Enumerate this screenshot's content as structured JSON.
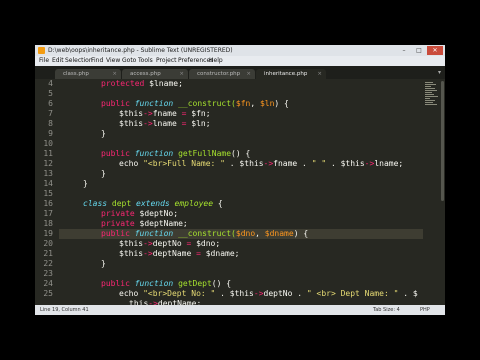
{
  "window": {
    "title": "D:\\web\\oops\\inheritance.php - Sublime Text (UNREGISTERED)",
    "controls": [
      "–",
      "□",
      "✕"
    ]
  },
  "menu": [
    "File",
    "Edit",
    "Selection",
    "Find",
    "View",
    "Goto",
    "Tools",
    "Project",
    "Preferences",
    "Help"
  ],
  "tabs": [
    {
      "label": "class.php",
      "active": false
    },
    {
      "label": "access.php",
      "active": false
    },
    {
      "label": "constructor.php",
      "active": false
    },
    {
      "label": "inheritance.php",
      "active": true
    }
  ],
  "line_numbers": [
    "4",
    "5",
    "6",
    "7",
    "8",
    "9",
    "10",
    "11",
    "12",
    "13",
    "14",
    "15",
    "16",
    "17",
    "18",
    "19",
    "20",
    "21",
    "22",
    "23",
    "24",
    "25",
    ""
  ],
  "code_lines": [
    [
      [
        "protected",
        "k"
      ],
      [
        " $lname;",
        ""
      ]
    ],
    [],
    [
      [
        "public ",
        "k"
      ],
      [
        "function",
        "s"
      ],
      [
        " __construct(",
        "f"
      ],
      [
        "$fn",
        "v"
      ],
      [
        ", ",
        ""
      ],
      [
        "$ln",
        "v"
      ],
      [
        ") {",
        ""
      ]
    ],
    [
      [
        "$this",
        ""
      ],
      [
        "->",
        "arr"
      ],
      [
        "fname ",
        ""
      ],
      [
        "=",
        "k"
      ],
      [
        " $fn;",
        ""
      ]
    ],
    [
      [
        "$this",
        ""
      ],
      [
        "->",
        "arr"
      ],
      [
        "lname ",
        ""
      ],
      [
        "=",
        "k"
      ],
      [
        " $ln;",
        ""
      ]
    ],
    [
      [
        "}",
        ""
      ]
    ],
    [],
    [
      [
        "public ",
        "k"
      ],
      [
        "function",
        "s"
      ],
      [
        " getFullName",
        "f"
      ],
      [
        "() {",
        ""
      ]
    ],
    [
      [
        "echo ",
        ""
      ],
      [
        "\"<br>Full Name: \"",
        "str"
      ],
      [
        " . $this",
        ""
      ],
      [
        "->",
        "arr"
      ],
      [
        "fname . ",
        ""
      ],
      [
        "\" \"",
        "str"
      ],
      [
        " . $this",
        ""
      ],
      [
        "->",
        "arr"
      ],
      [
        "lname;",
        ""
      ]
    ],
    [
      [
        "}",
        ""
      ]
    ],
    [
      [
        "}",
        ""
      ]
    ],
    [],
    [
      [
        "class ",
        "s"
      ],
      [
        "dept ",
        "f"
      ],
      [
        "extends ",
        "s"
      ],
      [
        "employee",
        "ty"
      ],
      [
        " {",
        ""
      ]
    ],
    [
      [
        "private ",
        "k"
      ],
      [
        "$deptNo;",
        ""
      ]
    ],
    [
      [
        "private ",
        "k"
      ],
      [
        "$deptName;",
        ""
      ]
    ],
    [
      [
        "public ",
        "k"
      ],
      [
        "function",
        "s"
      ],
      [
        " __construct(",
        "f"
      ],
      [
        "$dno",
        "v"
      ],
      [
        ", ",
        ""
      ],
      [
        "$dname",
        "v"
      ],
      [
        ") {",
        ""
      ]
    ],
    [
      [
        "$this",
        ""
      ],
      [
        "->",
        "arr"
      ],
      [
        "deptNo ",
        ""
      ],
      [
        "=",
        "k"
      ],
      [
        " $dno;",
        ""
      ]
    ],
    [
      [
        "$this",
        ""
      ],
      [
        "->",
        "arr"
      ],
      [
        "deptName ",
        ""
      ],
      [
        "=",
        "k"
      ],
      [
        " $dname;",
        ""
      ]
    ],
    [
      [
        "}",
        ""
      ]
    ],
    [],
    [
      [
        "public ",
        "k"
      ],
      [
        "function",
        "s"
      ],
      [
        " getDept",
        "f"
      ],
      [
        "() {",
        ""
      ]
    ],
    [
      [
        "echo ",
        ""
      ],
      [
        "\"<br>Dept No: \"",
        "str"
      ],
      [
        " . $this",
        ""
      ],
      [
        "->",
        "arr"
      ],
      [
        "deptNo . ",
        ""
      ],
      [
        "\" <br> Dept Name: \"",
        "str"
      ],
      [
        " . $",
        ""
      ]
    ],
    [
      [
        "this",
        ""
      ],
      [
        "->",
        "arr"
      ],
      [
        "deptName;",
        ""
      ]
    ]
  ],
  "status": {
    "left": "Line 19, Column 41",
    "tab_size": "Tab Size: 4",
    "syntax": "PHP"
  },
  "colors": {
    "editor_bg": "#272822",
    "keyword": "#f92672",
    "storage": "#66d9ef",
    "function_name": "#a6e22e",
    "string": "#e6db74",
    "parameter": "#fd971f"
  }
}
